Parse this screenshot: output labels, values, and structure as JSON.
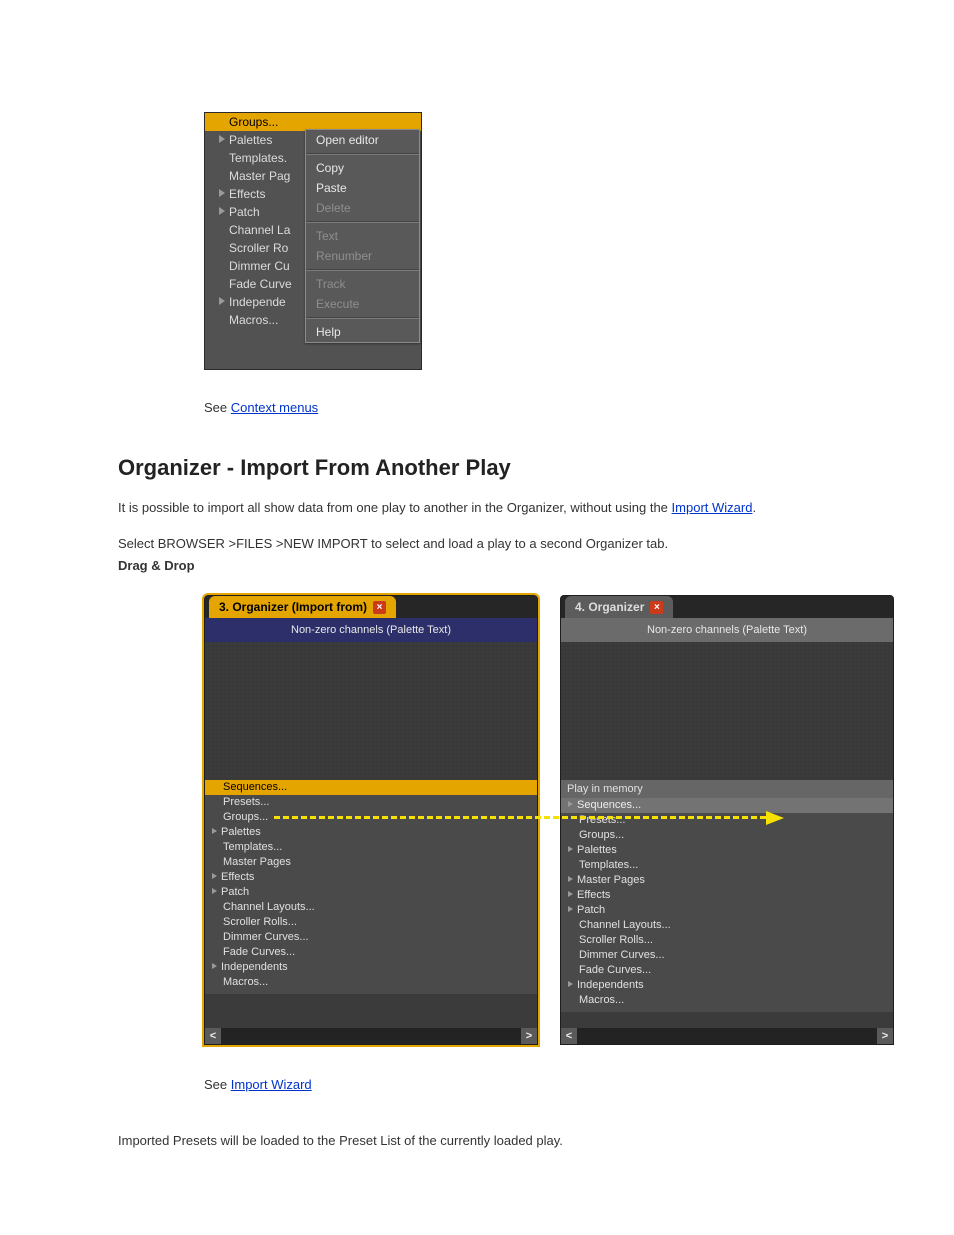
{
  "shot1": {
    "tree": [
      {
        "label": "Groups...",
        "kind": "leaf",
        "selected": true
      },
      {
        "label": "Palettes",
        "kind": "branch"
      },
      {
        "label": "Templates.",
        "kind": "leaf"
      },
      {
        "label": "Master Pag",
        "kind": "leaf"
      },
      {
        "label": "Effects",
        "kind": "branch"
      },
      {
        "label": "Patch",
        "kind": "branch"
      },
      {
        "label": "Channel La",
        "kind": "leaf"
      },
      {
        "label": "Scroller Ro",
        "kind": "leaf"
      },
      {
        "label": "Dimmer Cu",
        "kind": "leaf"
      },
      {
        "label": "Fade Curve",
        "kind": "leaf"
      },
      {
        "label": "Independe",
        "kind": "branch"
      },
      {
        "label": "Macros...",
        "kind": "leaf"
      }
    ],
    "menu": [
      {
        "label": "Open editor",
        "enabled": true
      },
      {
        "sep": true
      },
      {
        "label": "Copy",
        "enabled": true
      },
      {
        "label": "Paste",
        "enabled": true
      },
      {
        "label": "Delete",
        "enabled": false
      },
      {
        "sep": true
      },
      {
        "label": "Text",
        "enabled": false
      },
      {
        "label": "Renumber",
        "enabled": false
      },
      {
        "sep": true
      },
      {
        "label": "Track",
        "enabled": false
      },
      {
        "label": "Execute",
        "enabled": false
      },
      {
        "sep": true
      },
      {
        "label": "Help",
        "enabled": true
      }
    ]
  },
  "links": {
    "link1": "Context menus",
    "link2": "Import Wizard"
  },
  "text": {
    "see1a": "See ",
    "h1": "Organizer - Import From Another Play",
    "p1a": "It is possible to import all show data from one play to another in the Organizer, without using the",
    "p1b": ".",
    "p2": "Select BROWSER >FILES >NEW IMPORT to select and load a play to a second Organizer tab.",
    "p3": "Imported Presets will be loaded to the Preset List of the currently loaded play.",
    "label": "Drag & Drop"
  },
  "shot2": {
    "left": {
      "tab": "3. Organizer (Import from)",
      "header": "Non-zero channels (Palette Text)",
      "subheader": "",
      "rows": [
        {
          "label": "Sequences...",
          "kind": "leaf",
          "sel": "yellow"
        },
        {
          "label": "Presets...",
          "kind": "leaf"
        },
        {
          "label": "Groups...",
          "kind": "leaf"
        },
        {
          "label": "Palettes",
          "kind": "branch"
        },
        {
          "label": "Templates...",
          "kind": "leaf"
        },
        {
          "label": "Master Pages",
          "kind": "leaf"
        },
        {
          "label": "Effects",
          "kind": "branch"
        },
        {
          "label": "Patch",
          "kind": "branch"
        },
        {
          "label": "Channel Layouts...",
          "kind": "leaf"
        },
        {
          "label": "Scroller Rolls...",
          "kind": "leaf"
        },
        {
          "label": "Dimmer Curves...",
          "kind": "leaf"
        },
        {
          "label": "Fade Curves...",
          "kind": "leaf"
        },
        {
          "label": "Independents",
          "kind": "branch"
        },
        {
          "label": "Macros...",
          "kind": "leaf"
        }
      ]
    },
    "right": {
      "tab": "4. Organizer",
      "header": "Non-zero channels (Palette Text)",
      "subheader": "Play in memory",
      "rows": [
        {
          "label": "Sequences...",
          "kind": "branch",
          "sel": "grey"
        },
        {
          "label": "Presets...",
          "kind": "leaf"
        },
        {
          "label": "Groups...",
          "kind": "leaf"
        },
        {
          "label": "Palettes",
          "kind": "branch"
        },
        {
          "label": "Templates...",
          "kind": "leaf"
        },
        {
          "label": "Master Pages",
          "kind": "branch"
        },
        {
          "label": "Effects",
          "kind": "branch"
        },
        {
          "label": "Patch",
          "kind": "branch"
        },
        {
          "label": "Channel Layouts...",
          "kind": "leaf"
        },
        {
          "label": "Scroller Rolls...",
          "kind": "leaf"
        },
        {
          "label": "Dimmer Curves...",
          "kind": "leaf"
        },
        {
          "label": "Fade Curves...",
          "kind": "leaf"
        },
        {
          "label": "Independents",
          "kind": "branch"
        },
        {
          "label": "Macros...",
          "kind": "leaf"
        }
      ]
    }
  },
  "scroll": {
    "lt": "<",
    "gt": ">"
  }
}
